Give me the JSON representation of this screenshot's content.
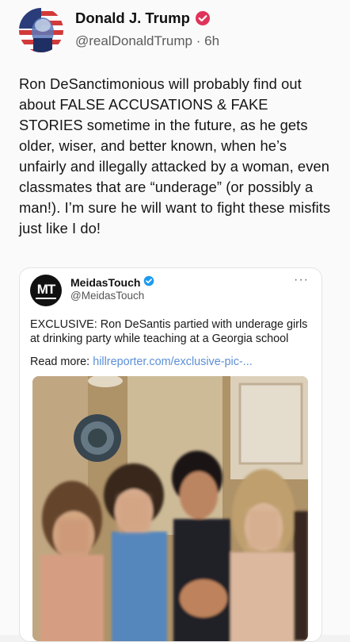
{
  "post": {
    "author_name": "Donald J. Trump",
    "handle": "@realDonaldTrump",
    "separator": "·",
    "time": "6h",
    "text": "Ron DeSanctimonious will probably find out about FALSE ACCUSATIONS & FAKE STORIES sometime in the future, as he gets older, wiser, and better known, when he’s unfairly and illegally attacked by a woman, even classmates that are “underage” (or possibly a man!). I’m sure he will want to fight these misfits just like I do!",
    "verified_badge_color": "#e0335a"
  },
  "quoted": {
    "avatar_text": "MT",
    "author_name": "MeidasTouch",
    "handle": "@MeidasTouch",
    "more_icon": "···",
    "text": "EXCLUSIVE: Ron DeSantis partied with underage girls at drinking party while teaching at a Georgia school",
    "read_more_label": "Read more:",
    "read_more_link": "hillreporter.com/exclusive-pic-...",
    "verified_badge_color": "#1d9bf0",
    "link_color": "#5b8fd6"
  }
}
